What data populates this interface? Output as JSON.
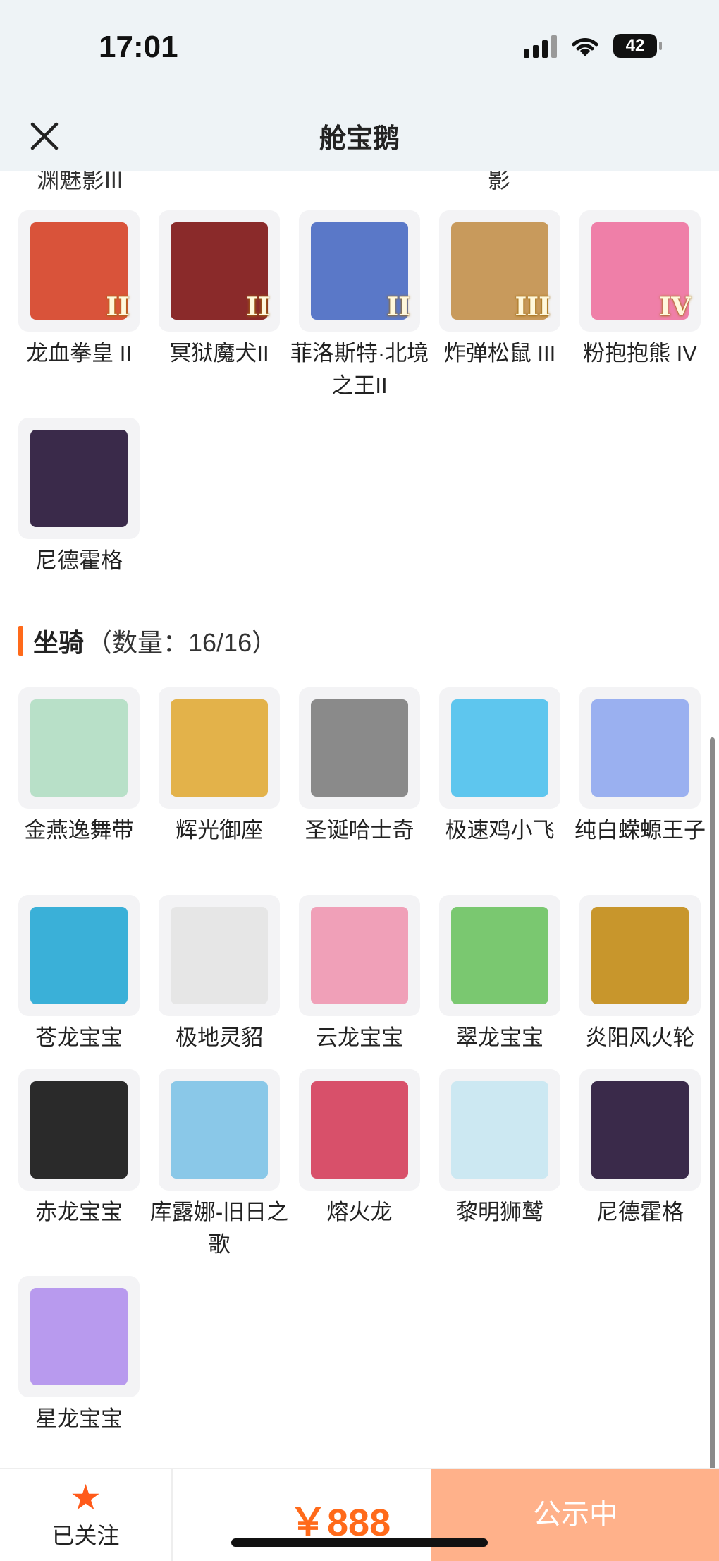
{
  "status": {
    "time": "17:01",
    "battery": "42"
  },
  "header": {
    "title": "舱宝鹅",
    "close_icon": "close-icon"
  },
  "partial_labels": [
    "渊魅影III",
    "影"
  ],
  "pets_row": [
    {
      "name": "龙血拳皇 II",
      "badge": "II",
      "color": "#d9533a"
    },
    {
      "name": "冥狱魔犬II",
      "badge": "II",
      "color": "#8a2a2a"
    },
    {
      "name": "菲洛斯特·北境之王II",
      "badge": "II",
      "color": "#5a78c8"
    },
    {
      "name": "炸弹松鼠 III",
      "badge": "III",
      "color": "#c89a5c"
    },
    {
      "name": "粉抱抱熊 IV",
      "badge": "IV",
      "color": "#ef7fa8"
    },
    {
      "name": "尼德霍格",
      "badge": "",
      "color": "#3a2a4a"
    }
  ],
  "mounts_section": {
    "title": "坐骑",
    "count": "（数量：16/16）"
  },
  "mounts": [
    {
      "name": "金燕逸舞带",
      "color": "#b8e0c8"
    },
    {
      "name": "辉光御座",
      "color": "#e3b24a"
    },
    {
      "name": "圣诞哈士奇",
      "color": "#8a8a8a"
    },
    {
      "name": "极速鸡小飞",
      "color": "#5ec6ee"
    },
    {
      "name": "纯白蝾螈王子",
      "color": "#9ab0f0"
    },
    {
      "name": "苍龙宝宝",
      "color": "#3ab0d8"
    },
    {
      "name": "极地灵貂",
      "color": "#e6e6e6"
    },
    {
      "name": "云龙宝宝",
      "color": "#f0a0b8"
    },
    {
      "name": "翠龙宝宝",
      "color": "#7ac870"
    },
    {
      "name": "炎阳风火轮",
      "color": "#c8962c"
    },
    {
      "name": "赤龙宝宝",
      "color": "#2a2a2a"
    },
    {
      "name": "库露娜-旧日之歌",
      "color": "#8ac8e8"
    },
    {
      "name": "熔火龙",
      "color": "#d8506a"
    },
    {
      "name": "黎明狮鹫",
      "color": "#cce8f2"
    },
    {
      "name": "尼德霍格",
      "color": "#3a2a4a"
    },
    {
      "name": "星龙宝宝",
      "color": "#b89aee"
    }
  ],
  "bottom": {
    "follow_label": "已关注",
    "price": "￥888",
    "status_button": "公示中"
  }
}
